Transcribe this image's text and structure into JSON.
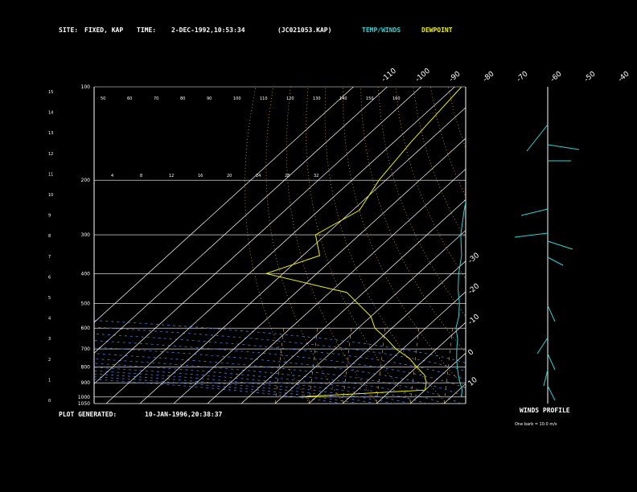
{
  "header": {
    "site_label": "SITE:",
    "site_value": "FIXED, KAP",
    "time_label": "TIME:",
    "time_value": "2-DEC-1992,10:53:34",
    "file_name": "(JC021053.KAP)",
    "temp_winds_label": "TEMP/WINDS",
    "dewpoint_label": "DEWPOINT"
  },
  "footer": {
    "generated_label": "PLOT GENERATED:",
    "generated_value": "10-JAN-1996,20:38:37"
  },
  "winds": {
    "title": "WINDS PROFILE",
    "note": "One barb = 10.0 m/s"
  },
  "colors": {
    "background": "#000000",
    "axes": "#ffffff",
    "temperature": "#2ed3d3",
    "dewpoint": "#f0f000",
    "isotherm": "#ffffff",
    "dry_adiabat": "#d49a3c",
    "moist_adiabat": "#4a7bd4",
    "mixing_ratio": "#d4a040"
  },
  "chart_data": {
    "type": "line",
    "title": "",
    "xlabel": "",
    "ylabel": "",
    "pressure_labels": [
      "100",
      "200",
      "300",
      "400",
      "500",
      "600",
      "700",
      "800",
      "900",
      "1000",
      "1050"
    ],
    "height_labels": [
      "15",
      "14",
      "13",
      "12",
      "11",
      "10",
      "9",
      "8",
      "7",
      "6",
      "5",
      "4",
      "3",
      "2",
      "1",
      "0"
    ],
    "top_temp_labels": [
      "-110",
      "-100",
      "-90",
      "-80",
      "-70",
      "-60",
      "-50",
      "-40"
    ],
    "right_temp_labels": [
      "-30",
      "-20",
      "-10",
      "0",
      "10",
      "20",
      "30"
    ],
    "theta_labels": [
      "50",
      "60",
      "70",
      "80",
      "90",
      "100",
      "110",
      "120",
      "130",
      "140",
      "150",
      "160"
    ],
    "mixing_ratio_labels": [
      "4",
      "8",
      "12",
      "16",
      "20",
      "24",
      "28",
      "32"
    ],
    "series": [
      {
        "name": "TEMP/WINDS",
        "pressure_hPa": [
          100,
          120,
          140,
          160,
          200,
          250,
          300,
          350,
          400,
          450,
          500,
          550,
          600,
          650,
          700,
          750,
          800,
          850,
          900,
          950,
          1000
        ],
        "temperature_C": [
          -75,
          -72,
          -68,
          -62,
          -55,
          -47,
          -40,
          -33,
          -28,
          -23,
          -18,
          -14,
          -11,
          -7,
          -4,
          -1,
          2,
          5,
          8,
          11,
          13
        ]
      },
      {
        "name": "DEWPOINT",
        "pressure_hPa": [
          100,
          150,
          200,
          250,
          300,
          350,
          400,
          450,
          460,
          500,
          550,
          600,
          650,
          700,
          750,
          800,
          850,
          900,
          950,
          1000
        ],
        "dewpoint_C": [
          -88,
          -85,
          -82,
          -78,
          -83,
          -75,
          -85,
          -60,
          -55,
          -48,
          -40,
          -35,
          -28,
          -22,
          -15,
          -10,
          -5,
          -2,
          0,
          -35
        ]
      }
    ]
  }
}
